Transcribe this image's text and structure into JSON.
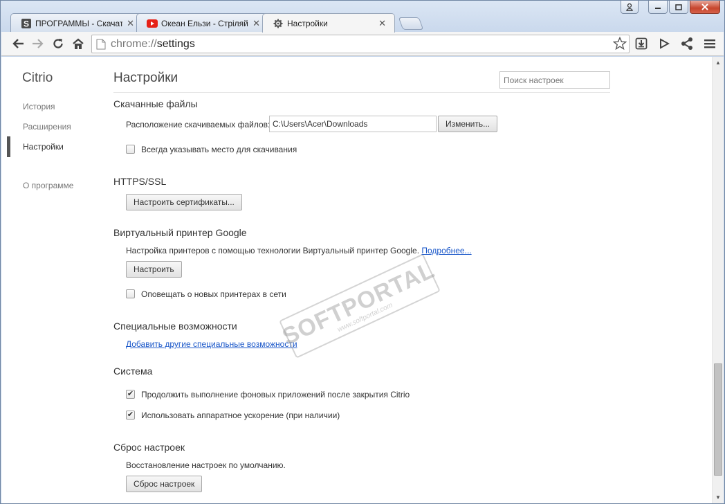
{
  "window": {
    "tabs": [
      {
        "label": "ПРОГРАММЫ - Скачать б",
        "favicon": "softportal-s-icon"
      },
      {
        "label": "Океан Ельзи - Стріляй (о",
        "favicon": "youtube-icon"
      },
      {
        "label": "Настройки",
        "favicon": "gear-icon"
      }
    ]
  },
  "toolbar": {
    "url_scheme": "chrome://",
    "url_path": "settings"
  },
  "sidebar": {
    "brand": "Citrio",
    "items": [
      "История",
      "Расширения",
      "Настройки",
      "О программе"
    ]
  },
  "main": {
    "title": "Настройки",
    "search_placeholder": "Поиск настроек",
    "downloads": {
      "title": "Скачанные файлы",
      "location_label": "Расположение скачиваемых файлов:",
      "location_value": "C:\\Users\\Acer\\Downloads",
      "change_button": "Изменить...",
      "ask_checkbox": "Всегда указывать место для скачивания"
    },
    "https": {
      "title": "HTTPS/SSL",
      "certs_button": "Настроить сертификаты..."
    },
    "cloudprint": {
      "title": "Виртуальный принтер Google",
      "description": "Настройка принтеров с помощью технологии Виртуальный принтер Google.",
      "more_link": "Подробнее...",
      "setup_button": "Настроить",
      "notify_checkbox": "Оповещать о новых принтерах в сети"
    },
    "accessibility": {
      "title": "Специальные возможности",
      "add_link": "Добавить другие специальные возможности"
    },
    "system": {
      "title": "Система",
      "bg_apps_checkbox": "Продолжить выполнение фоновых приложений после закрытия Citrio",
      "hw_accel_checkbox": "Использовать аппаратное ускорение (при наличии)"
    },
    "reset": {
      "title": "Сброс настроек",
      "description": "Восстановление настроек по умолчанию.",
      "reset_button": "Сброс настроек"
    }
  },
  "watermark": {
    "main": "SOFTPORTAL",
    "sub": "www.softportal.com"
  }
}
